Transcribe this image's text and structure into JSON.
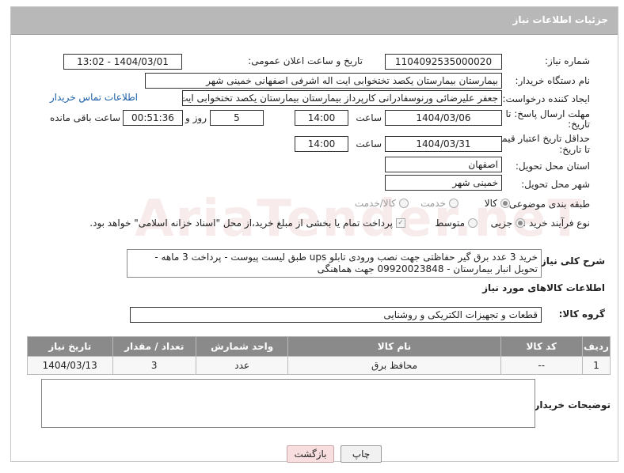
{
  "header": {
    "title": "جزئیات اطلاعات نیاز"
  },
  "fields": {
    "need_number_label": "شماره نیاز:",
    "need_number": "1104092535000020",
    "announce_label": "تاریخ و ساعت اعلان عمومی:",
    "announce_value": "1404/03/01 - 13:02",
    "buyer_org_label": "نام دستگاه خریدار:",
    "buyer_org": "بیمارستان بیمارستان یکصد تختخوابی ایت اله اشرفی اصفهانی خمینی شهر",
    "creator_label": "ایجاد کننده درخواست:",
    "creator": "جعفر علیرضائی ورنوسفادرانی کارپرداز بیمارستان بیمارستان یکصد تختخوابی ایت",
    "contact_link": "اطلاعات تماس خریدار",
    "reply_deadline_label_1": "مهلت ارسال پاسخ: تا",
    "reply_deadline_label_2": "تاریخ:",
    "reply_date": "1404/03/06",
    "hour_label": "ساعت",
    "reply_time": "14:00",
    "days_value": "5",
    "days_label": "روز و",
    "remaining_value": "00:51:36",
    "remaining_label": "ساعت باقی مانده",
    "price_deadline_label_1": "حداقل تاریخ اعتبار قیمت:",
    "price_deadline_label_2": "تا تاریخ:",
    "price_date": "1404/03/31",
    "price_hour_label": "ساعت",
    "price_time": "14:00",
    "province_label": "استان محل تحویل:",
    "province": "اصفهان",
    "city_label": "شهر محل تحویل:",
    "city": "خمینی شهر",
    "category_label": "طبقه بندی موضوعی:",
    "category_options": [
      "کالا",
      "خدمت",
      "کالا/خدمت"
    ],
    "process_label": "نوع فرآیند خرید :",
    "process_options": [
      "جزیی",
      "متوسط"
    ],
    "payment_note": "پرداخت تمام یا بخشی از مبلغ خرید،از محل \"اسناد خزانه اسلامی\" خواهد بود.",
    "summary_label": "شرح کلی نیاز:",
    "summary": "خرید 3 عدد برق گیر حفاظتی جهت نصب ورودی تابلو ups طبق لیست پیوست - پرداخت 3 ماهه - تحویل انبار بیمارستان - 09920023848 جهت هماهنگی"
  },
  "goods": {
    "section_title": "اطلاعات کالاهای مورد نیاز",
    "group_label": "گروه کالا:",
    "group_value": "قطعات و تجهیزات الکتریکی و روشنایی",
    "columns": [
      "ردیف",
      "کد کالا",
      "نام کالا",
      "واحد شمارش",
      "تعداد / مقدار",
      "تاریخ نیاز"
    ],
    "rows": [
      [
        "1",
        "--",
        "محافظ برق",
        "عدد",
        "3",
        "1404/03/13"
      ]
    ]
  },
  "buyer_notes_label": "توضیحات خریدار:",
  "buttons": {
    "print": "چاپ",
    "back": "بازگشت"
  },
  "watermark": "AriaTender.neT"
}
